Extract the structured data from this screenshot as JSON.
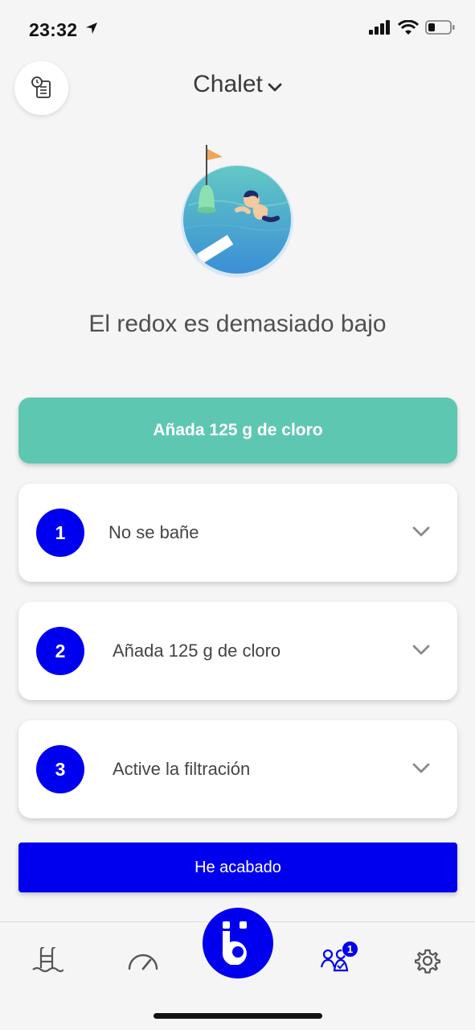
{
  "status": {
    "time": "23:32"
  },
  "header": {
    "title": "Chalet"
  },
  "hero": {
    "message": "El redox es demasiado bajo"
  },
  "primary_action": {
    "label": "Añada 125 g de cloro"
  },
  "steps": [
    {
      "number": "1",
      "label": "No se bañe"
    },
    {
      "number": "2",
      "label": "Añada 125 g de cloro"
    },
    {
      "number": "3",
      "label": "Active la filtración"
    }
  ],
  "done": {
    "label": "He acabado"
  },
  "tabbar": {
    "items": [
      {
        "icon": "pool-ladder-icon"
      },
      {
        "icon": "gauge-icon"
      },
      {
        "icon": "brand-logo-icon"
      },
      {
        "icon": "tasks-people-icon",
        "badge": "1"
      },
      {
        "icon": "gear-icon"
      }
    ]
  },
  "colors": {
    "accent": "#0000ee",
    "teal": "#5ec7b2",
    "background": "#f5f5f5"
  }
}
